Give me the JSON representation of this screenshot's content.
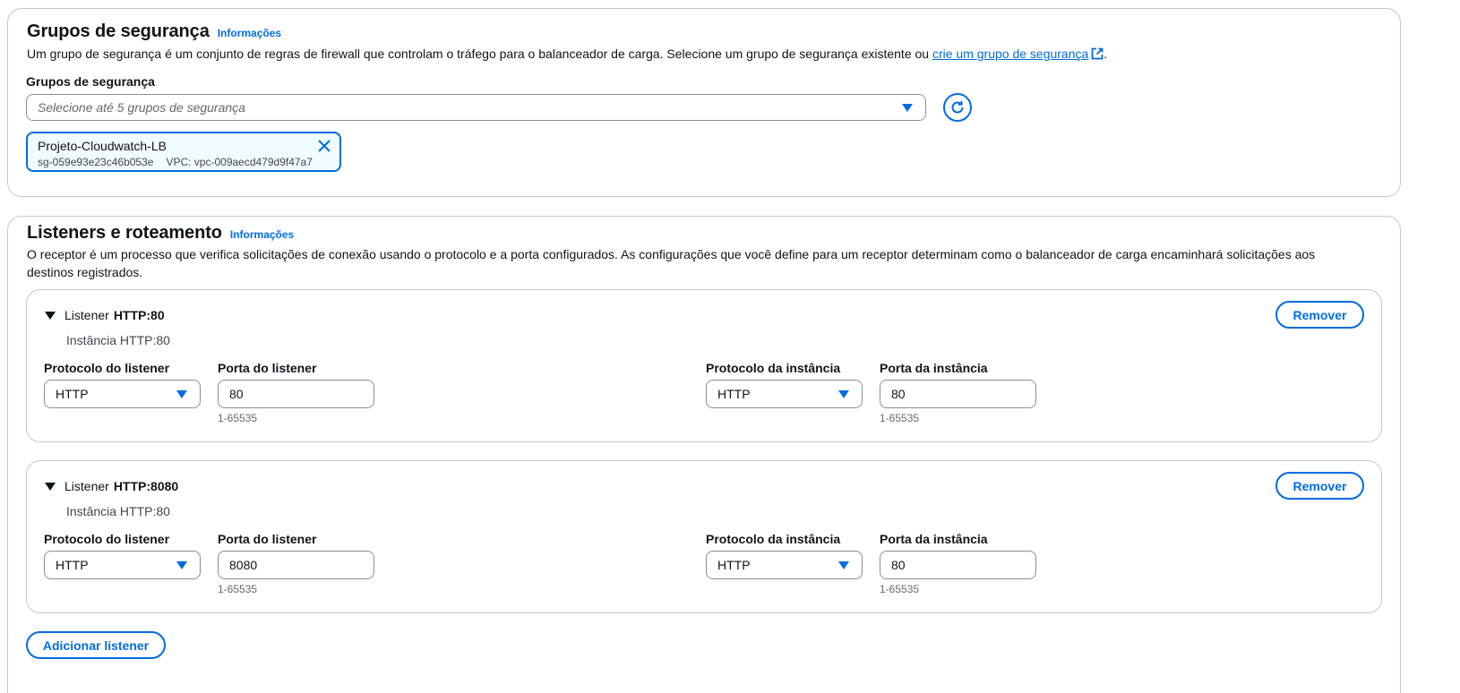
{
  "security_groups": {
    "title": "Grupos de segurança",
    "info_link": "Informações",
    "description_prefix": "Um grupo de segurança é um conjunto de regras de firewall que controlam o tráfego para o balanceador de carga. Selecione um grupo de segurança existente ou ",
    "description_link": "crie um grupo de segurança",
    "description_suffix": ".",
    "field_label": "Grupos de segurança",
    "select_placeholder": "Selecione até 5 grupos de segurança",
    "selected_token": {
      "name": "Projeto-Cloudwatch-LB",
      "id": "sg-059e93e23c46b053e",
      "vpc": "VPC: vpc-009aecd479d9f47a7"
    }
  },
  "listeners_routing": {
    "title": "Listeners e roteamento",
    "info_link": "Informações",
    "description": "O receptor é um processo que verifica solicitações de conexão usando o protocolo e a porta configurados. As configurações que você define para um receptor determinam como o balanceador de carga encaminhará solicitações aos destinos registrados.",
    "add_button": "Adicionar listener",
    "listeners": [
      {
        "prefix": "Listener",
        "name": "HTTP:80",
        "subtitle": "Instância HTTP:80",
        "remove_label": "Remover",
        "listener_protocol_label": "Protocolo do listener",
        "listener_protocol": "HTTP",
        "listener_port_label": "Porta do listener",
        "listener_port": "80",
        "listener_port_hint": "1-65535",
        "instance_protocol_label": "Protocolo da instância",
        "instance_protocol": "HTTP",
        "instance_port_label": "Porta da instância",
        "instance_port": "80",
        "instance_port_hint": "1-65535"
      },
      {
        "prefix": "Listener",
        "name": "HTTP:8080",
        "subtitle": "Instância HTTP:80",
        "remove_label": "Remover",
        "listener_protocol_label": "Protocolo do listener",
        "listener_protocol": "HTTP",
        "listener_port_label": "Porta do listener",
        "listener_port": "8080",
        "listener_port_hint": "1-65535",
        "instance_protocol_label": "Protocolo da instância",
        "instance_protocol": "HTTP",
        "instance_port_label": "Porta da instância",
        "instance_port": "80",
        "instance_port_hint": "1-65535"
      }
    ]
  },
  "colors": {
    "link_blue": "#006ce0",
    "text": "#0f141a",
    "border": "#c6c6cd",
    "token_bg": "#f0fbff"
  },
  "icons": [
    "external-link-icon",
    "refresh-icon",
    "close-icon",
    "caret-down-icon",
    "expand-triangle-icon"
  ]
}
